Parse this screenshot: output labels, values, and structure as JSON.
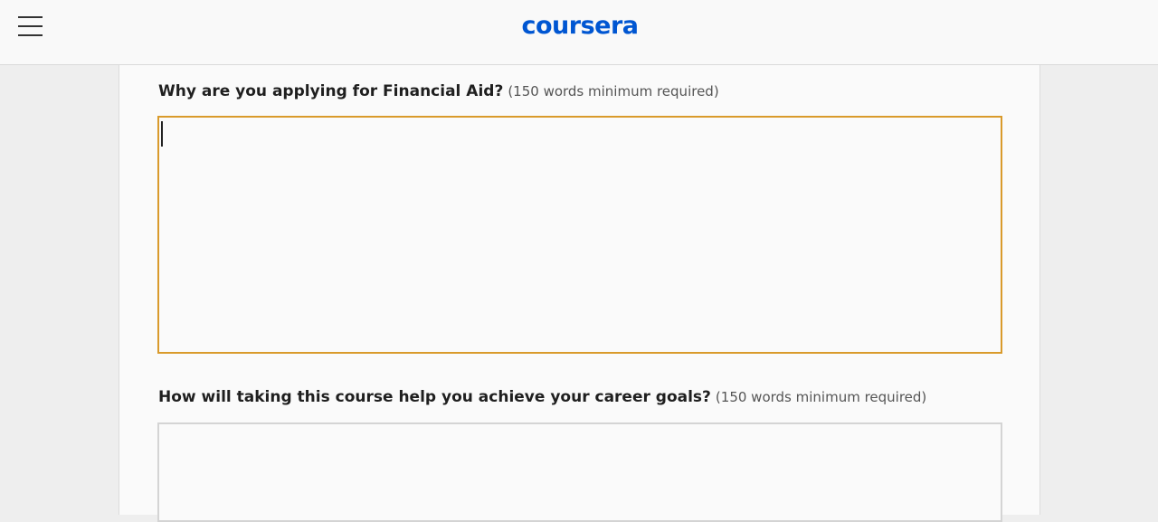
{
  "header": {
    "menu_icon": "hamburger-menu-icon",
    "logo_text": "coursera",
    "brand_color": "#0056d2"
  },
  "form": {
    "question1": {
      "label": "Why are you applying for Financial Aid?",
      "hint": "(150 words minimum required)",
      "value": ""
    },
    "question2": {
      "label": "How will taking this course help you achieve your career goals?",
      "hint": "(150 words minimum required)",
      "value": ""
    },
    "focus_color": "#d99a2b"
  }
}
